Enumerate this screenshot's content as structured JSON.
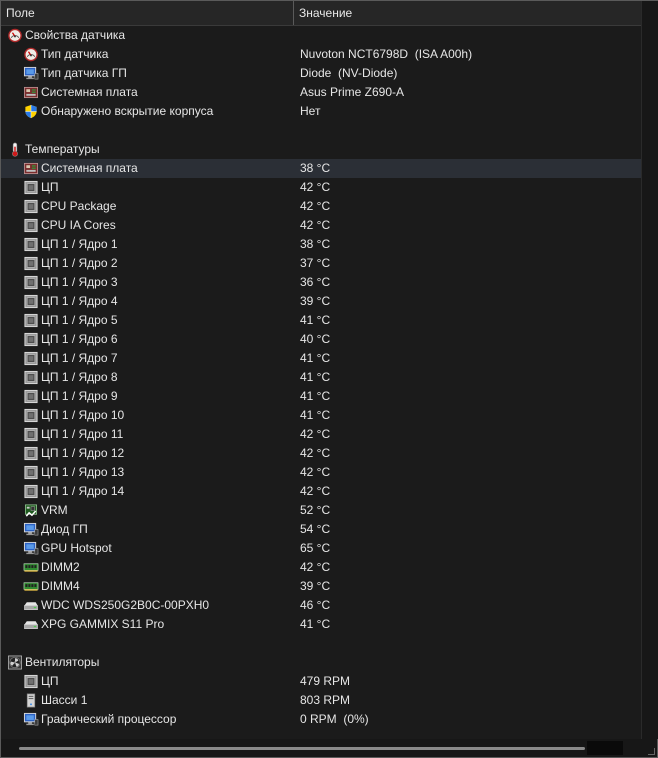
{
  "header": {
    "field": "Поле",
    "value": "Значение"
  },
  "rows": [
    {
      "kind": "section",
      "icon": "gauge-icon",
      "label": "Свойства датчика",
      "value": ""
    },
    {
      "kind": "item",
      "icon": "gauge-icon",
      "label": "Тип датчика",
      "value": "Nuvoton NCT6798D  (ISA A00h)"
    },
    {
      "kind": "item",
      "icon": "monitor-icon",
      "label": "Тип датчика ГП",
      "value": "Diode  (NV-Diode)"
    },
    {
      "kind": "item",
      "icon": "motherboard-icon",
      "label": "Системная плата",
      "value": "Asus Prime Z690-A"
    },
    {
      "kind": "item",
      "icon": "shield-icon",
      "label": "Обнаружено вскрытие корпуса",
      "value": "Нет"
    },
    {
      "kind": "blank",
      "icon": "",
      "label": "",
      "value": ""
    },
    {
      "kind": "section",
      "icon": "thermometer-icon",
      "label": "Температуры",
      "value": ""
    },
    {
      "kind": "item",
      "icon": "motherboard-icon",
      "label": "Системная плата",
      "value": "38 °C",
      "selected": true
    },
    {
      "kind": "item",
      "icon": "cpu-icon",
      "label": "ЦП",
      "value": "42 °C"
    },
    {
      "kind": "item",
      "icon": "cpu-icon",
      "label": "CPU Package",
      "value": "42 °C"
    },
    {
      "kind": "item",
      "icon": "cpu-icon",
      "label": "CPU IA Cores",
      "value": "42 °C"
    },
    {
      "kind": "item",
      "icon": "cpu-icon",
      "label": "ЦП 1 / Ядро 1",
      "value": "38 °C"
    },
    {
      "kind": "item",
      "icon": "cpu-icon",
      "label": "ЦП 1 / Ядро 2",
      "value": "37 °C"
    },
    {
      "kind": "item",
      "icon": "cpu-icon",
      "label": "ЦП 1 / Ядро 3",
      "value": "36 °C"
    },
    {
      "kind": "item",
      "icon": "cpu-icon",
      "label": "ЦП 1 / Ядро 4",
      "value": "39 °C"
    },
    {
      "kind": "item",
      "icon": "cpu-icon",
      "label": "ЦП 1 / Ядро 5",
      "value": "41 °C"
    },
    {
      "kind": "item",
      "icon": "cpu-icon",
      "label": "ЦП 1 / Ядро 6",
      "value": "40 °C"
    },
    {
      "kind": "item",
      "icon": "cpu-icon",
      "label": "ЦП 1 / Ядро 7",
      "value": "41 °C"
    },
    {
      "kind": "item",
      "icon": "cpu-icon",
      "label": "ЦП 1 / Ядро 8",
      "value": "41 °C"
    },
    {
      "kind": "item",
      "icon": "cpu-icon",
      "label": "ЦП 1 / Ядро 9",
      "value": "41 °C"
    },
    {
      "kind": "item",
      "icon": "cpu-icon",
      "label": "ЦП 1 / Ядро 10",
      "value": "41 °C"
    },
    {
      "kind": "item",
      "icon": "cpu-icon",
      "label": "ЦП 1 / Ядро 11",
      "value": "42 °C"
    },
    {
      "kind": "item",
      "icon": "cpu-icon",
      "label": "ЦП 1 / Ядро 12",
      "value": "42 °C"
    },
    {
      "kind": "item",
      "icon": "cpu-icon",
      "label": "ЦП 1 / Ядро 13",
      "value": "42 °C"
    },
    {
      "kind": "item",
      "icon": "cpu-icon",
      "label": "ЦП 1 / Ядро 14",
      "value": "42 °C"
    },
    {
      "kind": "item",
      "icon": "vrm-icon",
      "label": "VRM",
      "value": "52 °C"
    },
    {
      "kind": "item",
      "icon": "monitor-icon",
      "label": "Диод ГП",
      "value": "54 °C"
    },
    {
      "kind": "item",
      "icon": "monitor-icon",
      "label": "GPU Hotspot",
      "value": "65 °C"
    },
    {
      "kind": "item",
      "icon": "memory-icon",
      "label": "DIMM2",
      "value": "42 °C"
    },
    {
      "kind": "item",
      "icon": "memory-icon",
      "label": "DIMM4",
      "value": "39 °C"
    },
    {
      "kind": "item",
      "icon": "drive-icon",
      "label": "WDC WDS250G2B0C-00PXH0",
      "value": "46 °C"
    },
    {
      "kind": "item",
      "icon": "drive-icon",
      "label": "XPG GAMMIX S11 Pro",
      "value": "41 °C"
    },
    {
      "kind": "blank",
      "icon": "",
      "label": "",
      "value": ""
    },
    {
      "kind": "section",
      "icon": "fan-icon",
      "label": "Вентиляторы",
      "value": ""
    },
    {
      "kind": "item",
      "icon": "cpu-icon",
      "label": "ЦП",
      "value": "479 RPM"
    },
    {
      "kind": "item",
      "icon": "case-icon",
      "label": "Шасси 1",
      "value": "803 RPM"
    },
    {
      "kind": "item",
      "icon": "monitor-icon",
      "label": "Графический процессор",
      "value": "0 RPM  (0%)"
    }
  ]
}
